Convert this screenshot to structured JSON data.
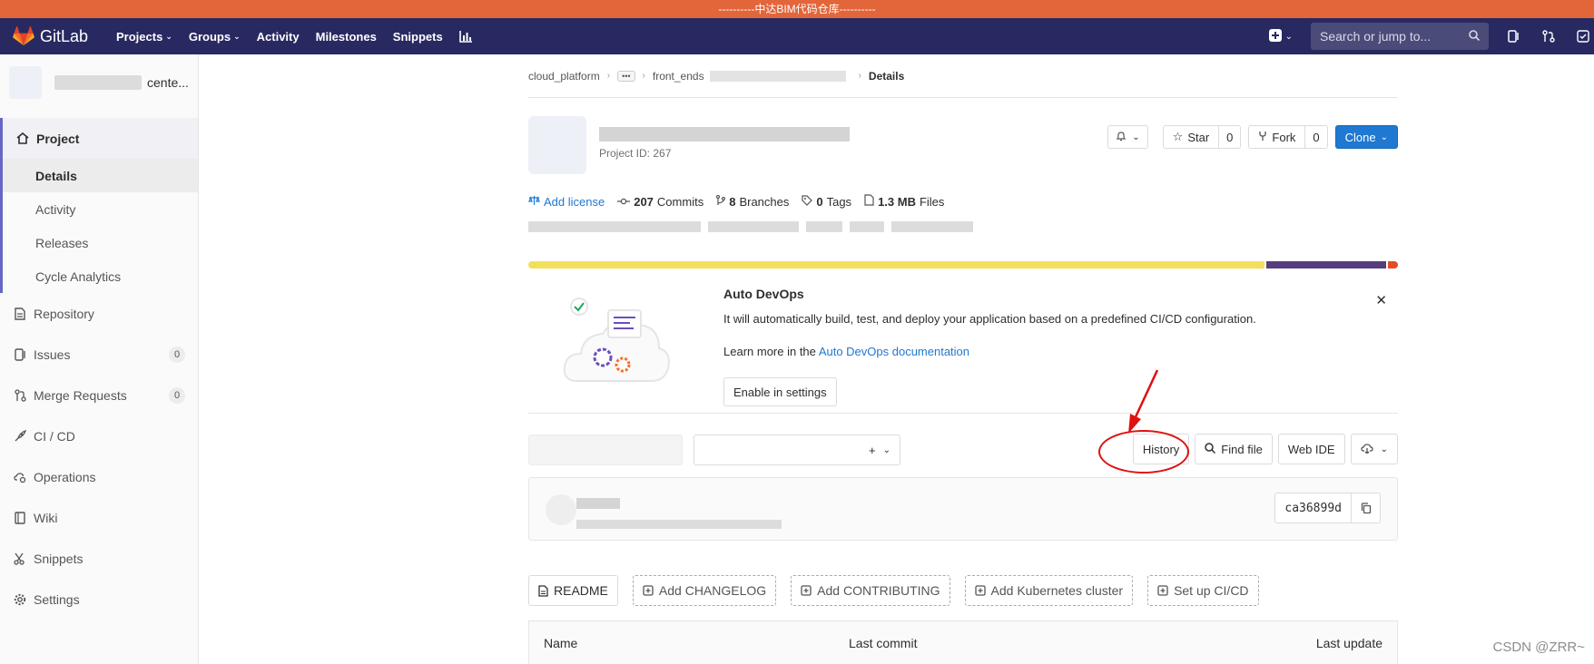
{
  "banner": {
    "text": "----------中达BIM代码仓库----------"
  },
  "topnav": {
    "brand": "GitLab",
    "items": [
      {
        "label": "Projects",
        "dropdown": true
      },
      {
        "label": "Groups",
        "dropdown": true
      },
      {
        "label": "Activity",
        "dropdown": false
      },
      {
        "label": "Milestones",
        "dropdown": false
      },
      {
        "label": "Snippets",
        "dropdown": false
      }
    ],
    "search_placeholder": "Search or jump to..."
  },
  "sidebar": {
    "project_name": "cente...",
    "project_label": "Project",
    "project_subitems": [
      "Details",
      "Activity",
      "Releases",
      "Cycle Analytics"
    ],
    "items": [
      {
        "label": "Repository",
        "icon": "doc-icon"
      },
      {
        "label": "Issues",
        "icon": "issues-icon",
        "count": "0"
      },
      {
        "label": "Merge Requests",
        "icon": "merge-icon",
        "count": "0"
      },
      {
        "label": "CI / CD",
        "icon": "rocket-icon"
      },
      {
        "label": "Operations",
        "icon": "cloud-gear-icon"
      },
      {
        "label": "Wiki",
        "icon": "book-icon"
      },
      {
        "label": "Snippets",
        "icon": "scissors-icon"
      },
      {
        "label": "Settings",
        "icon": "gear-icon"
      }
    ]
  },
  "breadcrumb": {
    "root": "cloud_platform",
    "group": "front_ends",
    "current": "Details"
  },
  "project": {
    "id_text": "Project ID: 267",
    "star_label": "Star",
    "star_count": "0",
    "fork_label": "Fork",
    "fork_count": "0",
    "clone_label": "Clone"
  },
  "stats": {
    "license": "Add license",
    "commits_count": "207",
    "commits_label": "Commits",
    "branches_count": "8",
    "branches_label": "Branches",
    "tags_count": "0",
    "tags_label": "Tags",
    "files_size": "1.3 MB",
    "files_label": "Files"
  },
  "colors": {
    "lang1": "#f1e05a",
    "lang2": "#563d7c",
    "lang3": "#e34c26",
    "accent": "#1f78d1"
  },
  "languages": [
    {
      "share": 0.849
    },
    {
      "share": 0.14
    },
    {
      "share": 0.011
    }
  ],
  "devops": {
    "title": "Auto DevOps",
    "text": "It will automatically build, test, and deploy your application based on a predefined CI/CD configuration.",
    "learn_prefix": "Learn more in the",
    "learn_link": "Auto DevOps documentation",
    "enable_label": "Enable in settings"
  },
  "tree": {
    "history": "History",
    "find_file": "Find file",
    "web_ide": "Web IDE"
  },
  "commit": {
    "sha": "ca36899d"
  },
  "quick_actions": {
    "readme": "README",
    "changelog": "Add CHANGELOG",
    "contributing": "Add CONTRIBUTING",
    "kubernetes": "Add Kubernetes cluster",
    "cicd": "Set up CI/CD"
  },
  "table": {
    "col_name": "Name",
    "col_commit": "Last commit",
    "col_update": "Last update"
  },
  "watermark": "CSDN @ZRR~"
}
